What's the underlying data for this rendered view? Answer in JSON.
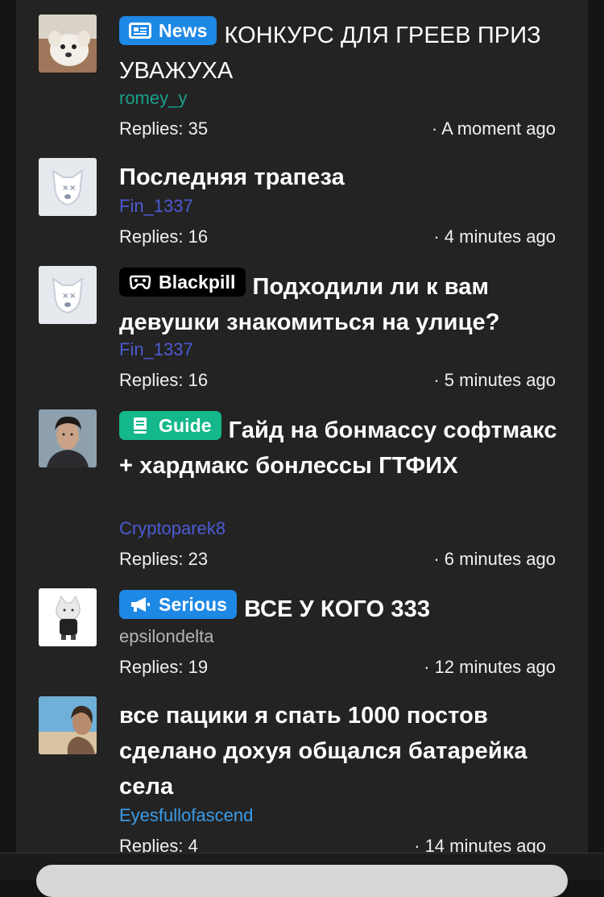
{
  "threads": [
    {
      "prefix": {
        "label": "News",
        "color": "#1e88e5",
        "icon": "newspaper-icon"
      },
      "title": "КОНКУРС ДЛЯ ГРЕЕВ ПРИЗ УВАЖУХА",
      "author": "romey_y",
      "author_color": "#19a08a",
      "replies": "Replies: 35",
      "time": "· A moment ago",
      "avatar": "dog-photo"
    },
    {
      "prefix": null,
      "title": "Последняя трапеза",
      "author": "Fin_1337",
      "author_color": "#4c5bd4",
      "replies": "Replies: 16",
      "time": "· 4 minutes ago",
      "avatar": "deleted-dog-avatar"
    },
    {
      "prefix": {
        "label": "Blackpill",
        "color": "#000000",
        "icon": "gamepad-icon"
      },
      "title": "Подходили ли к вам девушки знакомиться на улице?",
      "author": "Fin_1337",
      "author_color": "#4c5bd4",
      "replies": "Replies: 16",
      "time": "· 5 minutes ago",
      "avatar": "deleted-dog-avatar"
    },
    {
      "prefix": {
        "label": "Guide",
        "color": "#14b88a",
        "icon": "book-icon"
      },
      "title": "Гайд на бонмассу софтмакс + хардмакс бонлессы ГТФИХ",
      "author": "Cryptoparek8",
      "author_color": "#4c5bd4",
      "replies": "Replies: 23",
      "time": "· 6 minutes ago",
      "avatar": "man-portrait"
    },
    {
      "prefix": {
        "label": "Serious",
        "color": "#1e88e5",
        "icon": "megaphone-icon"
      },
      "title": "ВСЕ У КОГО 333",
      "author": "epsilondelta",
      "author_color": "#b4b4b4",
      "replies": "Replies: 19",
      "time": "· 12 minutes ago",
      "avatar": "cat-figure"
    },
    {
      "prefix": null,
      "title": "все пацики я спать 1000 постов сделано дохуя общался батарейка села",
      "author": "Eyesfullofascend",
      "author_color": "#3a9be8",
      "replies": "Replies: 4",
      "time": "· 14 minutes ago",
      "avatar": "beach-portrait"
    }
  ]
}
